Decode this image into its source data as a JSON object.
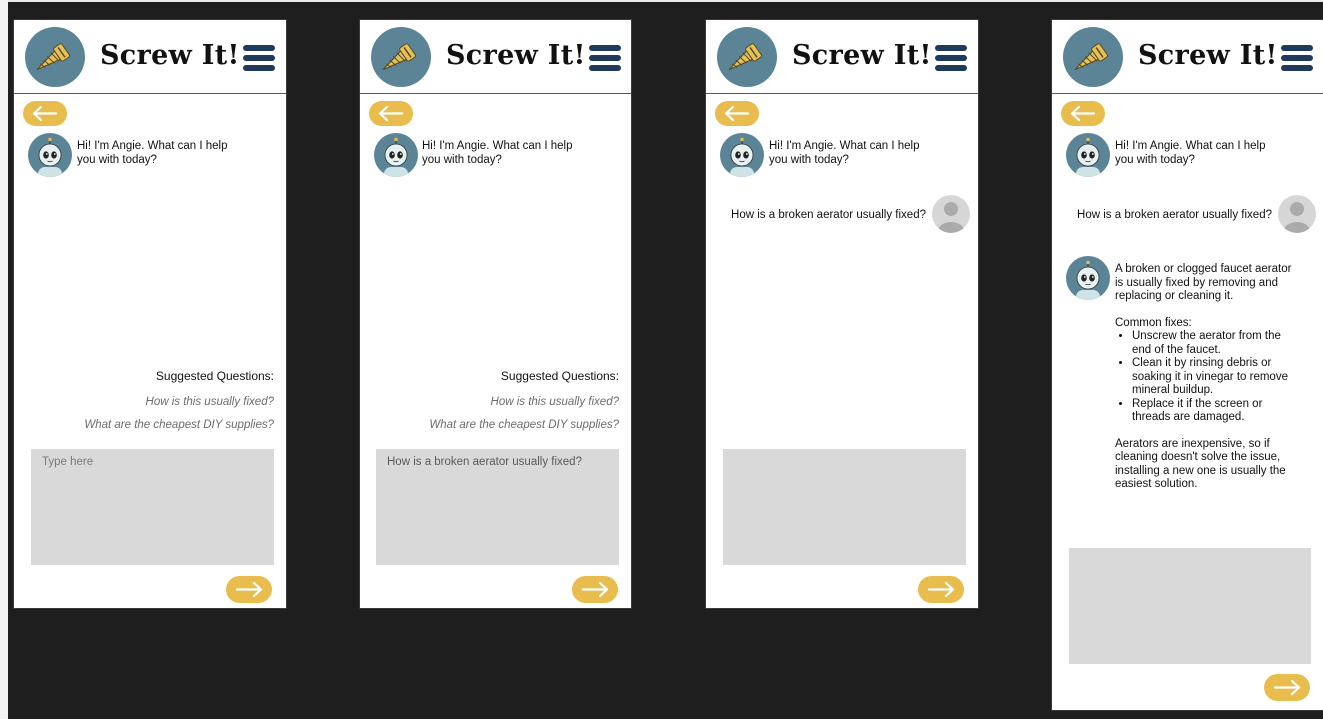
{
  "app": {
    "brand_title": "Screw It!"
  },
  "colors": {
    "canvas": "#1e1e1e",
    "accent_yellow": "#e9bd4d",
    "logo_teal": "#5b8596",
    "menu_navy": "#1f3a5c",
    "input_gray": "#d9d9d9"
  },
  "icons": {
    "logo": "screw-icon",
    "menu": "hamburger-menu-icon",
    "back": "arrow-left-icon",
    "send": "arrow-right-icon",
    "bot": "robot-avatar-icon",
    "user": "user-avatar-icon"
  },
  "screens": [
    {
      "greeting": "Hi! I'm Angie. What can I help\nyou with today?",
      "suggested_title": "Suggested Questions:",
      "suggested_questions": [
        "How is this usually fixed?",
        "What are the cheapest DIY supplies?"
      ],
      "input_value": "",
      "input_placeholder": "Type here"
    },
    {
      "greeting": "Hi! I'm Angie. What can I help\nyou with today?",
      "suggested_title": "Suggested Questions:",
      "suggested_questions": [
        "How is this usually fixed?",
        "What are the cheapest DIY supplies?"
      ],
      "input_value": "How is a broken aerator usually fixed?",
      "input_placeholder": ""
    },
    {
      "greeting": "Hi! I'm Angie. What can I help\nyou with today?",
      "user_message": "How is a broken aerator usually fixed?",
      "input_value": "",
      "input_placeholder": ""
    },
    {
      "greeting": "Hi! I'm Angie. What can I help\nyou with today?",
      "user_message": "How is a broken aerator usually fixed?",
      "answer": {
        "intro": "A broken or clogged faucet aerator is usually fixed by removing and replacing or cleaning it.",
        "fixes_heading": "Common fixes:",
        "fixes": [
          "Unscrew the aerator from the end of the faucet.",
          "Clean it by rinsing debris or soaking it in vinegar to remove mineral buildup.",
          "Replace it if the screen or threads are damaged."
        ],
        "closing": "Aerators are inexpensive, so if cleaning doesn't solve the issue, installing a new one is usually the easiest solution."
      },
      "input_value": "",
      "input_placeholder": ""
    }
  ]
}
